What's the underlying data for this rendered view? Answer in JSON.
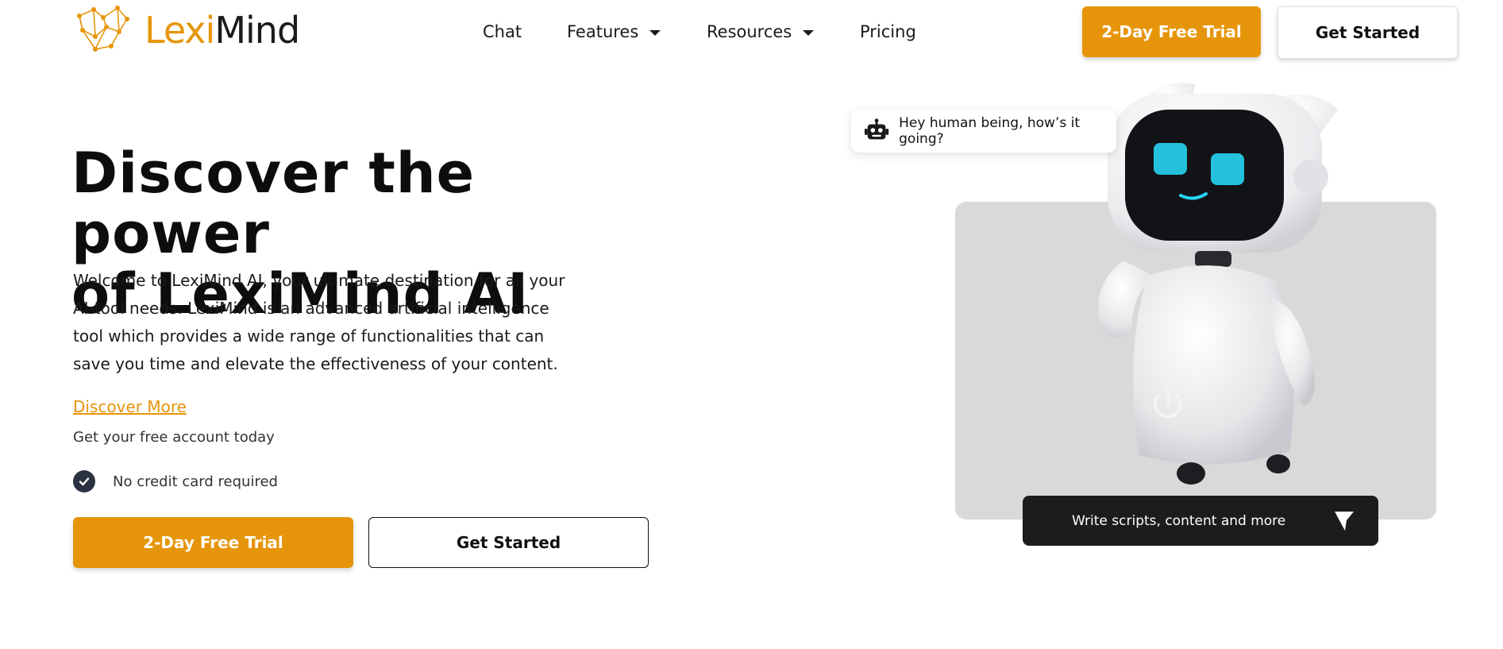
{
  "brand": {
    "name_part1": "Lexi",
    "name_part2": "Mind",
    "accent": "#e6950a"
  },
  "nav": {
    "items": [
      {
        "label": "Chat"
      },
      {
        "label": "Features",
        "has_dropdown": true
      },
      {
        "label": "Resources",
        "has_dropdown": true
      },
      {
        "label": "Pricing"
      }
    ]
  },
  "header_actions": {
    "trial_label": "2-Day Free Trial",
    "start_label": "Get Started"
  },
  "hero": {
    "title_line1": "Discover the power",
    "title_line2": "of LexiMind AI",
    "description": "Welcome to LexiMind AI, your ultimate destination for all your AI-tool needs. LexiMind is an advanced artificial intelligence tool which provides a wide range of functionalities that can save you time and elevate the effectiveness of your content.",
    "discover_link": "Discover More",
    "free_account": "Get your free account today",
    "no_card": "No credit card required",
    "trial_label": "2-Day Free Trial",
    "start_label": "Get Started"
  },
  "visual": {
    "bubble_text": "Hey human being, how’s it going?",
    "bar_text": "Write scripts, content and more",
    "icons": [
      "robot-icon",
      "cursor-icon",
      "check-icon",
      "caret-down-icon"
    ]
  }
}
